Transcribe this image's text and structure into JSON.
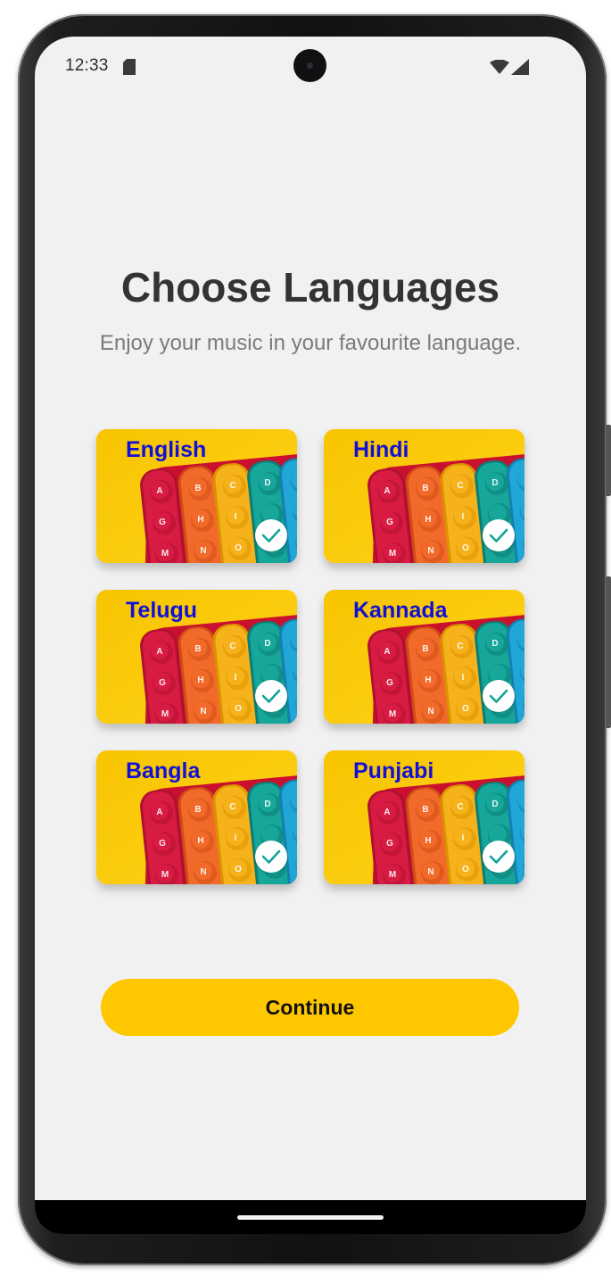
{
  "status_bar": {
    "time": "12:33",
    "icons": [
      "sd-card-icon",
      "wifi-icon",
      "signal-icon"
    ]
  },
  "header": {
    "title": "Choose Languages",
    "subtitle": "Enjoy your music in your favourite language."
  },
  "languages": [
    {
      "label": "English",
      "selected": true
    },
    {
      "label": "Hindi",
      "selected": true
    },
    {
      "label": "Telugu",
      "selected": true
    },
    {
      "label": "Kannada",
      "selected": true
    },
    {
      "label": "Bangla",
      "selected": true
    },
    {
      "label": "Punjabi",
      "selected": true
    }
  ],
  "card_art_letters": [
    "A",
    "B",
    "C",
    "D",
    "G",
    "H",
    "I",
    "M",
    "N",
    "O"
  ],
  "actions": {
    "continue_label": "Continue"
  },
  "colors": {
    "background": "#f1f1f1",
    "accent": "#fec700",
    "language_label": "#1010d8",
    "check": "#13a39a",
    "title": "#333333",
    "subtitle": "#7b7b7b"
  }
}
